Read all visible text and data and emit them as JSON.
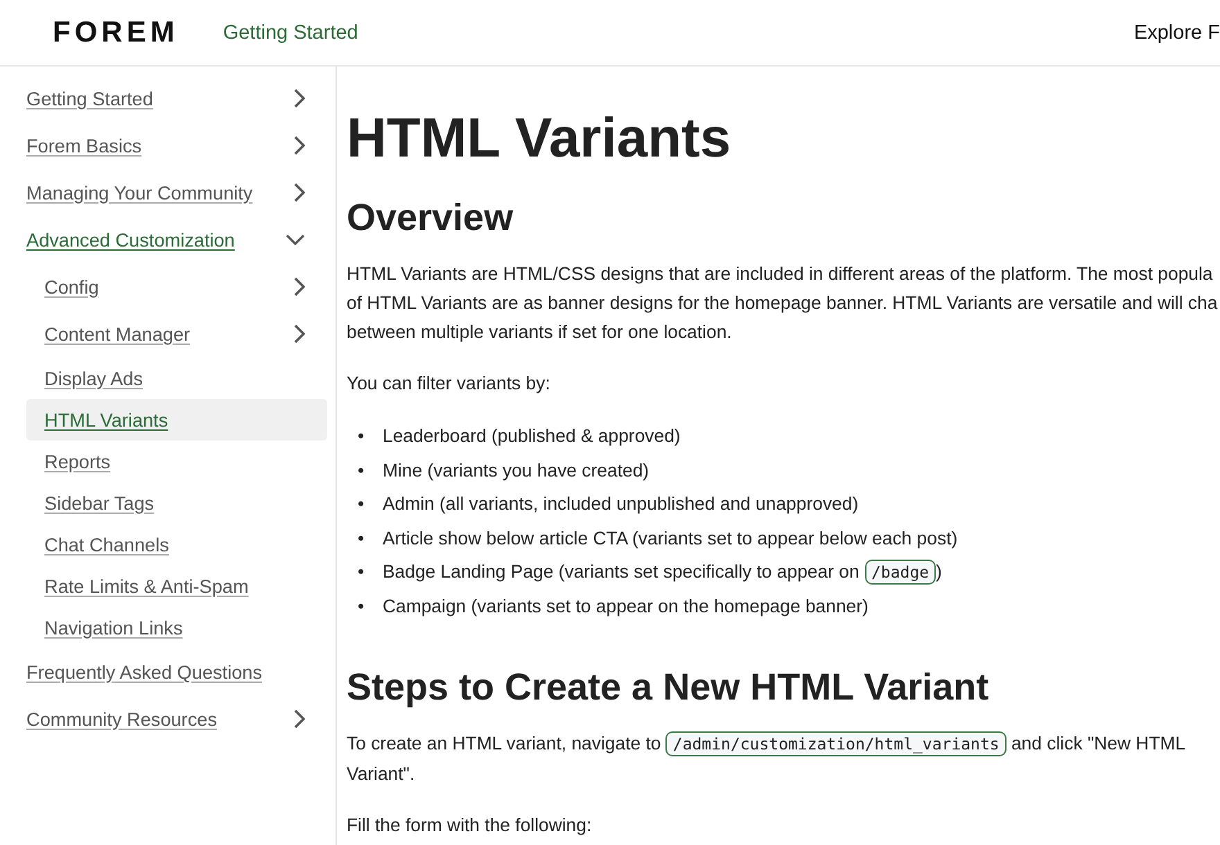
{
  "header": {
    "logo": "FOREM",
    "breadcrumb": "Getting Started",
    "right_link": "Explore F"
  },
  "sidebar": {
    "items": [
      {
        "label": "Getting Started",
        "kind": "section",
        "expanded": false,
        "selected": false
      },
      {
        "label": "Forem Basics",
        "kind": "section",
        "expanded": false,
        "selected": false
      },
      {
        "label": "Managing Your Community",
        "kind": "section",
        "expanded": false,
        "selected": false
      },
      {
        "label": "Advanced Customization",
        "kind": "section",
        "expanded": true,
        "selected": false,
        "children": [
          {
            "label": "Config",
            "kind": "section",
            "expanded": false,
            "selected": false
          },
          {
            "label": "Content Manager",
            "kind": "section",
            "expanded": false,
            "selected": false
          },
          {
            "label": "Display Ads",
            "kind": "page",
            "selected": false
          },
          {
            "label": "HTML Variants",
            "kind": "page",
            "selected": true
          },
          {
            "label": "Reports",
            "kind": "page",
            "selected": false
          },
          {
            "label": "Sidebar Tags",
            "kind": "page",
            "selected": false
          },
          {
            "label": "Chat Channels",
            "kind": "page",
            "selected": false
          },
          {
            "label": "Rate Limits & Anti-Spam",
            "kind": "page",
            "selected": false
          },
          {
            "label": "Navigation Links",
            "kind": "page",
            "selected": false
          }
        ]
      },
      {
        "label": "Frequently Asked Questions",
        "kind": "page",
        "selected": false
      },
      {
        "label": "Community Resources",
        "kind": "section",
        "expanded": false,
        "selected": false
      }
    ]
  },
  "content": {
    "title": "HTML Variants",
    "blocks": [
      {
        "kind": "heading",
        "text": "Overview"
      },
      {
        "kind": "paragraph",
        "lines": [
          [
            {
              "kind": "text",
              "text": "HTML Variants are HTML/CSS designs that are included in different areas of the platform. The most popula"
            }
          ],
          [
            {
              "kind": "text",
              "text": "of HTML Variants are as banner designs for the homepage banner. HTML Variants are versatile and will cha"
            }
          ],
          [
            {
              "kind": "text",
              "text": "between multiple variants if set for one location."
            }
          ]
        ]
      },
      {
        "kind": "paragraph",
        "lines": [
          [
            {
              "kind": "text",
              "text": "You can filter variants by:"
            }
          ]
        ]
      },
      {
        "kind": "list",
        "marker": "•",
        "items": [
          [
            {
              "kind": "text",
              "text": "Leaderboard (published & approved)"
            }
          ],
          [
            {
              "kind": "text",
              "text": "Mine (variants you have created)"
            }
          ],
          [
            {
              "kind": "text",
              "text": "Admin (all variants, included unpublished and unapproved)"
            }
          ],
          [
            {
              "kind": "text",
              "text": "Article show below article CTA (variants set to appear below each post)"
            }
          ],
          [
            {
              "kind": "text",
              "text": "Badge Landing Page (variants set specifically to appear on "
            },
            {
              "kind": "code",
              "text": "/badge"
            },
            {
              "kind": "text",
              "text": ")"
            }
          ],
          [
            {
              "kind": "text",
              "text": "Campaign (variants set to appear on the homepage banner)"
            }
          ]
        ]
      },
      {
        "kind": "heading",
        "text": "Steps to Create a New HTML Variant"
      },
      {
        "kind": "paragraph",
        "lines": [
          [
            {
              "kind": "text",
              "text": "To create an HTML variant, navigate to "
            },
            {
              "kind": "code",
              "text": "/admin/customization/html_variants"
            },
            {
              "kind": "text",
              "text": " and click \"New HTML"
            }
          ],
          [
            {
              "kind": "text",
              "text": "Variant\"."
            }
          ]
        ]
      },
      {
        "kind": "paragraph",
        "lines": [
          [
            {
              "kind": "text",
              "text": "Fill the form with the following:"
            }
          ]
        ]
      }
    ]
  }
}
